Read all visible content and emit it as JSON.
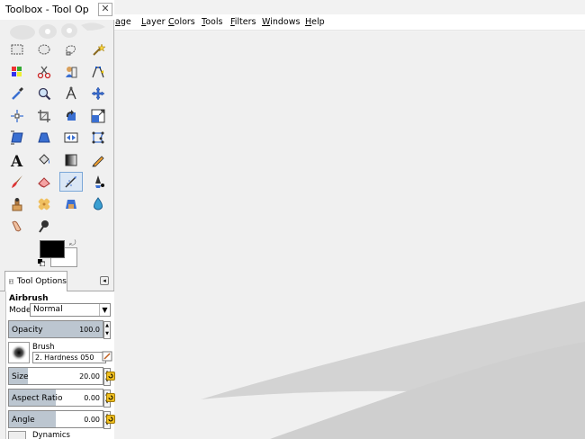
{
  "main": {
    "menus": [
      "age",
      "Layer",
      "Colors",
      "Tools",
      "Filters",
      "Windows",
      "Help"
    ],
    "menu_mnemonics": [
      "a",
      "L",
      "C",
      "T",
      "F",
      "W",
      "H"
    ]
  },
  "toolbox": {
    "title": "Toolbox - Tool Op",
    "close_glyph": "✕",
    "tools": [
      "rect-select",
      "ellipse-select",
      "free-select",
      "fuzzy-select",
      "select-by-color",
      "scissors",
      "foreground-select",
      "paths",
      "color-picker",
      "zoom",
      "measure",
      "move",
      "align",
      "crop",
      "rotate",
      "scale",
      "shear",
      "perspective",
      "flip",
      "cage-transform",
      "text",
      "bucket-fill",
      "blend",
      "pencil",
      "paintbrush",
      "eraser",
      "airbrush",
      "ink",
      "clone",
      "heal",
      "perspective-clone",
      "blur-sharpen",
      "smudge",
      "dodge-burn"
    ],
    "active_tool": "airbrush",
    "colors": {
      "foreground": "#000000",
      "background": "#ffffff"
    }
  },
  "tool_options": {
    "tab_label": "Tool Options",
    "tool_name": "Airbrush",
    "mode_label": "Mode:",
    "mode_value": "Normal",
    "opacity": {
      "label": "Opacity",
      "value": "100.0",
      "fraction": 1.0
    },
    "brush": {
      "label": "Brush",
      "name": "2. Hardness 050"
    },
    "size": {
      "label": "Size",
      "value": "20.00",
      "fraction": 0.2
    },
    "aspect_ratio": {
      "label": "Aspect Ratio",
      "value": "0.00",
      "fraction": 0.5
    },
    "angle": {
      "label": "Angle",
      "value": "0.00",
      "fraction": 0.5
    },
    "dynamics_label": "Dynamics"
  }
}
